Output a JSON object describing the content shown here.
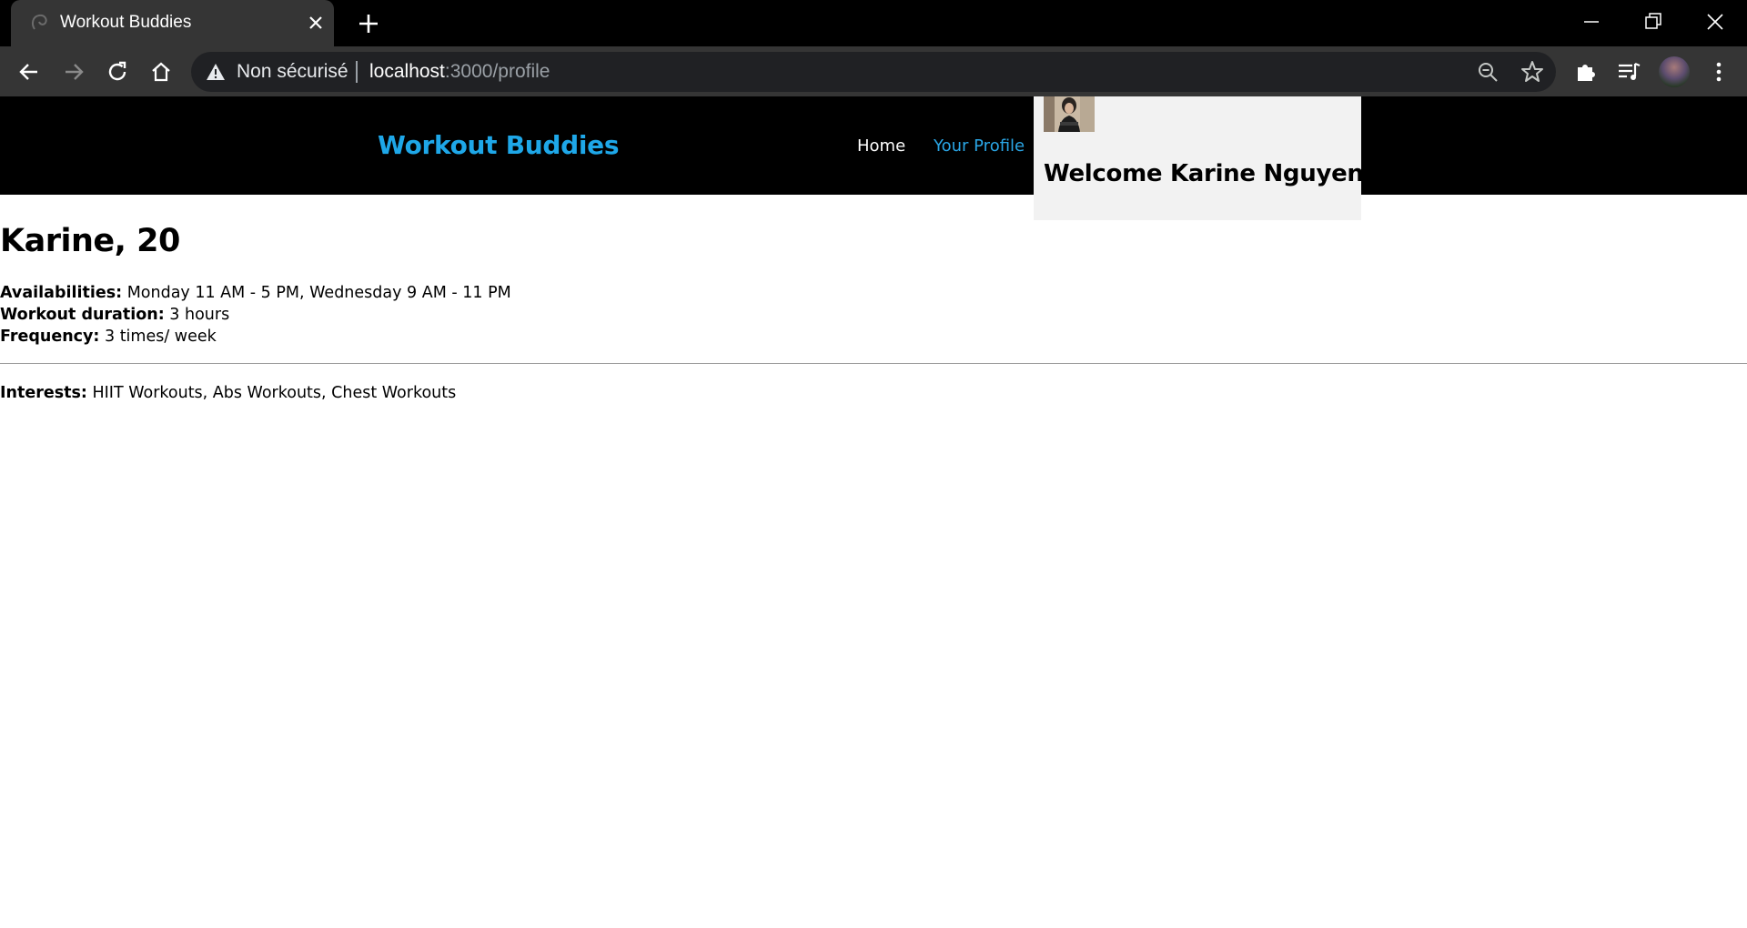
{
  "browser": {
    "tab_title": "Workout Buddies",
    "security_label": "Non sécurisé",
    "url_host": "localhost",
    "url_path": ":3000/profile"
  },
  "site": {
    "brand": "Workout Buddies",
    "nav": {
      "home": "Home",
      "profile": "Your Profile"
    },
    "welcome": "Welcome Karine Nguyen"
  },
  "profile": {
    "heading": "Karine, 20",
    "availabilities_label": "Availabilities:",
    "availabilities_value": " Monday 11 AM - 5 PM, Wednesday 9 AM - 11 PM",
    "duration_label": "Workout duration:",
    "duration_value": " 3 hours",
    "frequency_label": "Frequency:",
    "frequency_value": " 3 times/ week",
    "interests_label": "Interests:",
    "interests_value": " HIIT Workouts, Abs Workouts, Chest Workouts"
  },
  "colors": {
    "brand": "#1ea7e8",
    "active_nav": "#2aa6e6",
    "header_bg": "#000000",
    "welcome_bg": "#f2f2f2"
  },
  "icons": {
    "tab_favicon": "workout-favicon-icon",
    "close_tab": "close-icon",
    "new_tab": "plus-icon",
    "minimize": "minimize-icon",
    "restore": "restore-icon",
    "close_window": "close-icon",
    "back": "back-arrow-icon",
    "forward": "forward-arrow-icon",
    "reload": "reload-icon",
    "home": "home-icon",
    "warning": "warning-icon",
    "zoom": "zoom-out-icon",
    "bookmark": "star-icon",
    "extensions": "puzzle-icon",
    "media": "media-queue-icon",
    "profile": "avatar",
    "menu": "kebab-menu-icon"
  }
}
